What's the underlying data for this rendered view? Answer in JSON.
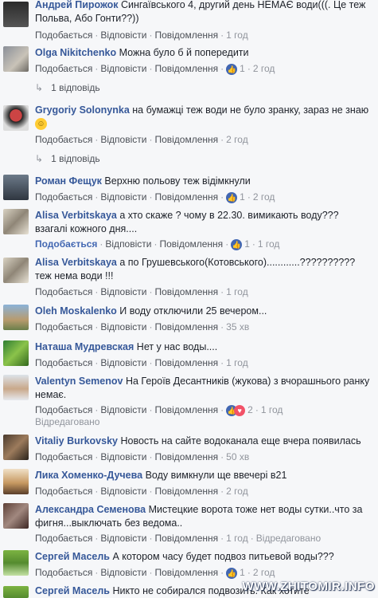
{
  "actions": {
    "like": "Подобається",
    "reply": "Відповісти",
    "report": "Повідомлення",
    "edited": "Відредаговано"
  },
  "comments": [
    {
      "author": "Андрей Пирожок",
      "text": "Сингаївського 4, другий день НЕМАЄ води(((. Це теж Польва, Або Гонти??))",
      "time": "1 год"
    },
    {
      "author": "Olga Nikitchenko",
      "text": "Можна було б й попередити",
      "reactions_count": "1",
      "time": "2 год",
      "replies": "1 відповідь"
    },
    {
      "author": "Grygoriy Solonynka",
      "text": "на бумажці теж води не було зранку, зараз не знаю",
      "time": "2 год",
      "replies": "1 відповідь"
    },
    {
      "author": "Роман Фещук",
      "text": "Верхню польову теж відімкнули",
      "reactions_count": "1",
      "time": "2 год"
    },
    {
      "author": "Alisa Verbitskaya",
      "text": "а хто скаже ? чому в 22.30. вимикають воду??? взагалі кожного дня....",
      "reactions_count": "1",
      "time": "1 год"
    },
    {
      "author": "Alisa Verbitskaya",
      "text": "а по Грушевського(Котовського)............?????????? теж нема води !!!",
      "time": "1 год"
    },
    {
      "author": "Oleh Moskalenko",
      "text": "И воду отключили 25 вечером...",
      "time": "35 хв"
    },
    {
      "author": "Наташа Мудревская",
      "text": "Нет у нас воды....",
      "time": "1 год"
    },
    {
      "author": "Valentyn Semenov",
      "text": "На Героїв Десантників (жукова) з вчорашнього ранку немає.",
      "reactions_count": "2",
      "time": "1 год"
    },
    {
      "author": "Vitaliy Burkovsky",
      "text": "Новость на сайте водоканала еще вчера появилась",
      "time": "50 хв"
    },
    {
      "author": "Лика Хоменко-Дучева",
      "text": "Воду вимкнули ще ввечері в21",
      "time": "2 год"
    },
    {
      "author": "Александра Семенова",
      "text": "Мистецкие ворота тоже нет воды сутки..что за фигня...выключать без ведома..",
      "time": "1 год"
    },
    {
      "author": "Сергей Масель",
      "text": "А котором часу будет подвоз питьевой воды???",
      "reactions_count": "1",
      "time": "2 год"
    },
    {
      "author": "Сергей Масель",
      "text": "Никто не собирался подвозить. Как хотите"
    }
  ],
  "watermark": "WWW.ZHITOMIR.INFO",
  "colors": {
    "background": "#f6f7f9",
    "author": "#365899",
    "like_blue": "#4267b2",
    "love_red": "#f25268",
    "meta_gray": "#90949c"
  },
  "icons": {
    "like": "thumbs-up-icon",
    "love": "heart-icon",
    "reply_arrow": "reply-arrow-icon",
    "emoji": "smile-emoji-icon"
  }
}
